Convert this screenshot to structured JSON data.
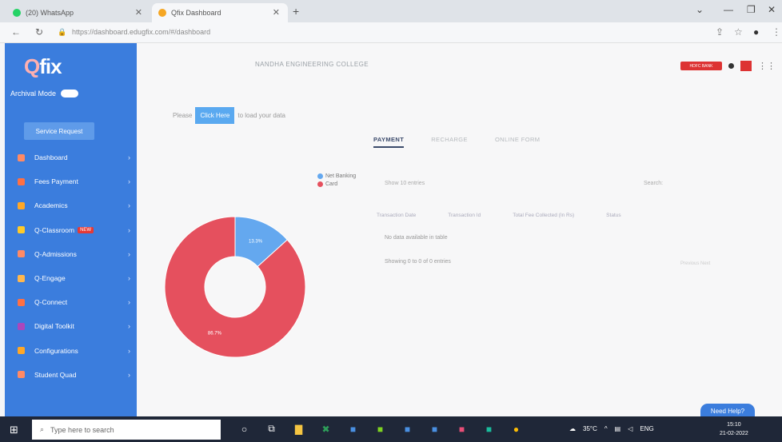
{
  "browser": {
    "tabs": [
      {
        "title": "(20) WhatsApp",
        "fav_color": "#25d366"
      },
      {
        "title": "Qfix Dashboard",
        "fav_color": "#f5a623"
      }
    ],
    "url": "https://dashboard.edugfix.com/#/dashboard"
  },
  "sidebar": {
    "logo": "fix",
    "logo_q": "Q",
    "archival_label": "Archival Mode",
    "service_request": "Service Request",
    "items": [
      {
        "label": "Dashboard",
        "icon_color": "#ff8a65",
        "badge": ""
      },
      {
        "label": "Fees Payment",
        "icon_color": "#ff7043",
        "badge": ""
      },
      {
        "label": "Academics",
        "icon_color": "#ffa726",
        "badge": ""
      },
      {
        "label": "Q-Classroom",
        "icon_color": "#ffca28",
        "badge": "NEW"
      },
      {
        "label": "Q-Admissions",
        "icon_color": "#ff8a65",
        "badge": ""
      },
      {
        "label": "Q-Engage",
        "icon_color": "#ffb74d",
        "badge": ""
      },
      {
        "label": "Q-Connect",
        "icon_color": "#ff7043",
        "badge": ""
      },
      {
        "label": "Digital Toolkit",
        "icon_color": "#ab47bc",
        "badge": ""
      },
      {
        "label": "Configurations",
        "icon_color": "#ffa726",
        "badge": ""
      },
      {
        "label": "Student Quad",
        "icon_color": "#ff8a65",
        "badge": ""
      }
    ]
  },
  "header": {
    "college": "NANDHA ENGINEERING COLLEGE",
    "bank_badge": "HDFC BANK"
  },
  "notice": {
    "please": "Please",
    "click_here": "Click Here",
    "suffix": "to load your data"
  },
  "tabs": [
    "PAYMENT",
    "RECHARGE",
    "ONLINE FORM"
  ],
  "legend": [
    {
      "label": "Net Banking",
      "color": "#64a8ef"
    },
    {
      "label": "Card",
      "color": "#e5505e"
    }
  ],
  "chart_data": {
    "type": "pie",
    "categories": [
      "Net Banking",
      "Card"
    ],
    "values": [
      13.3,
      86.7
    ],
    "labels": [
      "13.3%",
      "86.7%"
    ],
    "colors": [
      "#64a8ef",
      "#e5505e"
    ]
  },
  "table": {
    "show_entries": "Show 10 entries",
    "search": "Search:",
    "headers": [
      "Transaction Date",
      "Transaction Id",
      "Total Fee Collected (In Rs)",
      "Status"
    ],
    "no_data": "No data available in table",
    "showing": "Showing 0 to 0 of 0 entries",
    "pager": "Previous   Next"
  },
  "need_help": "Need Help?",
  "taskbar": {
    "search": "Type here to search",
    "weather": "35°C",
    "lang": "ENG",
    "time": "15:10",
    "date": "21-02-2022"
  }
}
